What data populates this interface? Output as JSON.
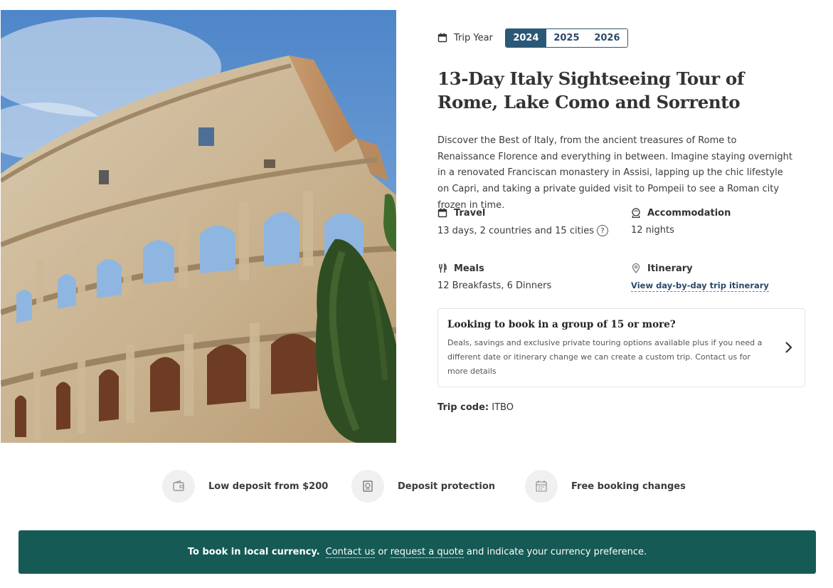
{
  "hero": {
    "image_alt": "Colosseum in Rome"
  },
  "trip_year": {
    "label": "Trip Year",
    "options": [
      "2024",
      "2025",
      "2026"
    ],
    "selected": "2024"
  },
  "title": "13-Day Italy Sightseeing Tour of Rome, Lake Como and Sorrento",
  "description": "Discover the Best of Italy, from the ancient treasures of Rome to Renaissance Florence and everything in between. Imagine staying overnight in a renovated Franciscan monastery in Assisi, lapping up the chic lifestyle on Capri, and taking a private guided visit to Pompeii to see a Roman city frozen in time.",
  "facts": {
    "travel": {
      "label": "Travel",
      "value": "13 days, 2 countries and 15 cities",
      "help": "?"
    },
    "accommodation": {
      "label": "Accommodation",
      "value": "12 nights"
    },
    "meals": {
      "label": "Meals",
      "value": "12 Breakfasts, 6 Dinners"
    },
    "itinerary": {
      "label": "Itinerary",
      "link": "View day-by-day trip itinerary"
    }
  },
  "group_card": {
    "title": "Looking to book in a group of 15 or more?",
    "text": "Deals, savings and exclusive private touring options available plus if you need a different date or itinerary change we can create a custom trip. Contact us for more details"
  },
  "trip_code": {
    "label": "Trip code:",
    "value": "ITBO"
  },
  "features": [
    {
      "label": "Low deposit from $200",
      "icon": "wallet-icon"
    },
    {
      "label": "Deposit protection",
      "icon": "passport-icon"
    },
    {
      "label": "Free booking changes",
      "icon": "calendar-icon"
    }
  ],
  "banner": {
    "bold": "To book in local currency.",
    "link1": "Contact us",
    "mid": "or",
    "link2": "request a quote",
    "tail": "and indicate your currency preference."
  },
  "colors": {
    "primary_blue": "#2b5876",
    "banner_green": "#155a54",
    "link_underline": "#d9534f"
  }
}
